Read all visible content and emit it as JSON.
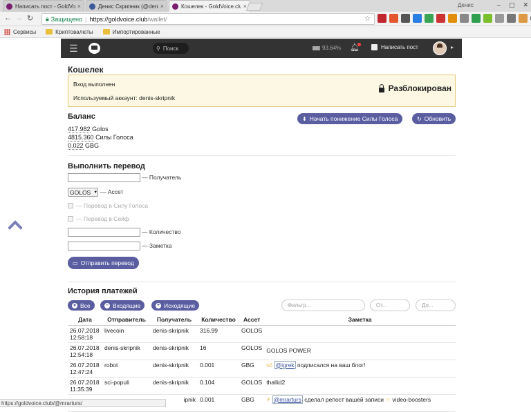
{
  "browser": {
    "tabs": [
      {
        "title": "Написать пост - GoldVoic",
        "active": false
      },
      {
        "title": "Денис Скрипник (@deni",
        "active": false
      },
      {
        "title": "Кошелек - GoldVoice.clu",
        "active": true
      }
    ],
    "window_user": "Денис",
    "address": {
      "secure_label": "Защищено",
      "host": "https://goldvoice.club",
      "path": "/wallet/"
    },
    "bookmarks": [
      {
        "label": "Сервисы",
        "icon": "apps-icon"
      },
      {
        "label": "Криптовалюты",
        "icon": "folder-icon"
      },
      {
        "label": "Импортированные",
        "icon": "folder-icon"
      }
    ],
    "status_url": "https://goldvoice.club/@mrarturs/"
  },
  "site_header": {
    "search_placeholder": "Поиск",
    "power_percent": "93.64%",
    "write_post": "Написать пост"
  },
  "wallet": {
    "title": "Кошелек",
    "login_status": "Вход выполнен",
    "account_label": "Используемый аккаунт: denis-skripnik",
    "unlocked_label": "Разблокирован",
    "balance_title": "Баланс",
    "balances": [
      {
        "amount": "417.982",
        "unit": "Golos"
      },
      {
        "amount": "4815.360",
        "unit": "Силы Голоса"
      },
      {
        "amount": "0.022",
        "unit": "GBG"
      }
    ],
    "power_down_button": "Начать понижение Силы Голоса",
    "refresh_button": "Обновить"
  },
  "transfer": {
    "title": "Выполнить перевод",
    "recipient_label": "— Получатель",
    "asset_value": "GOLOS",
    "asset_label": "— Ассет",
    "to_power_label": "— Перевод в Силу Голоса",
    "to_safe_label": "— Перевод в Сейф",
    "amount_label": "— Количество",
    "memo_label": "— Заметка",
    "send_button": "Отправить перевод"
  },
  "history": {
    "title": "История платежей",
    "filters": {
      "all": "Все",
      "incoming": "Входящие",
      "outgoing": "Исходящие"
    },
    "filter_placeholder": "Фильтр...",
    "from_placeholder": "От...",
    "to_placeholder": "До...",
    "columns": [
      "Дата",
      "Отправитель",
      "Получатель",
      "Количество",
      "Ассет",
      "Заметка"
    ],
    "rows": [
      {
        "date": "26.07.2018",
        "time": "12:58:18",
        "from": "livecoin",
        "to": "denis-skripnik",
        "amount": "316.99",
        "asset": "GOLOS",
        "memo_user": "",
        "memo": ""
      },
      {
        "date": "26.07.2018",
        "time": "12:54:18",
        "from": "denis-skripnik",
        "to": "denis-skripnik",
        "amount": "16",
        "asset": "GOLOS",
        "memo_user": "",
        "memo": "GOLOS POWER"
      },
      {
        "date": "26.07.2018",
        "time": "12:47:24",
        "from": "robot",
        "to": "denis-skripnik",
        "amount": "0.001",
        "asset": "GBG",
        "memo_user": "@igrek",
        "memo": "подписался на ваш блог!"
      },
      {
        "date": "26.07.2018",
        "time": "11:35:39",
        "from": "sci-populi",
        "to": "denis-skripnik",
        "amount": "0.104",
        "asset": "GOLOS",
        "memo_user": "",
        "memo": "thallid2"
      },
      {
        "date": "",
        "time": "",
        "from": "",
        "to": "ipnik",
        "amount": "0.001",
        "asset": "GBG",
        "memo_user": "@mrarturs",
        "memo": "сделал репост вашей записи",
        "memo_extra": "video-boosters"
      }
    ]
  },
  "colors": {
    "accent": "#5a5ea1",
    "header_bg": "#333333",
    "notice_bg": "#fcf8e3"
  }
}
